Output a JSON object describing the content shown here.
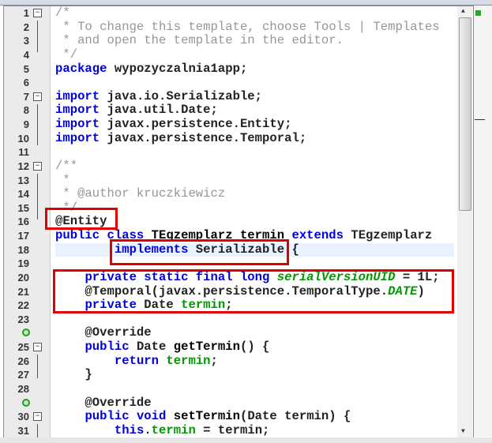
{
  "editor": {
    "current_line": 18,
    "lines": [
      [
        {
          "t": "/*",
          "c": "cm"
        }
      ],
      [
        {
          "t": " * To change this template, choose Tools | Templates",
          "c": "cm"
        }
      ],
      [
        {
          "t": " * and open the template in the editor.",
          "c": "cm"
        }
      ],
      [
        {
          "t": " */",
          "c": "cm"
        }
      ],
      [
        {
          "t": "package",
          "c": "k"
        },
        {
          "t": " wypozyczalnia1app;",
          "c": "a"
        }
      ],
      [],
      [
        {
          "t": "import",
          "c": "k"
        },
        {
          "t": " java.io.Serializable;",
          "c": "a"
        }
      ],
      [
        {
          "t": "import",
          "c": "k"
        },
        {
          "t": " java.util.Date;",
          "c": "a"
        }
      ],
      [
        {
          "t": "import",
          "c": "k"
        },
        {
          "t": " javax.persistence.Entity;",
          "c": "a"
        }
      ],
      [
        {
          "t": "import",
          "c": "k"
        },
        {
          "t": " javax.persistence.Temporal;",
          "c": "a"
        }
      ],
      [],
      [
        {
          "t": "/**",
          "c": "cm"
        }
      ],
      [
        {
          "t": " *",
          "c": "cm"
        }
      ],
      [
        {
          "t": " * @author kruczkiewicz",
          "c": "cm"
        }
      ],
      [
        {
          "t": " */",
          "c": "cm"
        }
      ],
      [
        {
          "t": "@Entity",
          "c": "a"
        }
      ],
      [
        {
          "t": "public class",
          "c": "k"
        },
        {
          "t": " ",
          "c": "a"
        },
        {
          "t": "TEgzemplarz termin",
          "c": "b"
        },
        {
          "t": " ",
          "c": "a"
        },
        {
          "t": "extends",
          "c": "k"
        },
        {
          "t": " TEgzemplarz",
          "c": "a"
        }
      ],
      [
        {
          "t": "        ",
          "c": "a"
        },
        {
          "t": "implements",
          "c": "k"
        },
        {
          "t": " Serializable {",
          "c": "a"
        }
      ],
      [],
      [
        {
          "t": "    ",
          "c": "a"
        },
        {
          "t": "private static final long",
          "c": "k"
        },
        {
          "t": " ",
          "c": "a"
        },
        {
          "t": "serialVersionUID",
          "c": "fi"
        },
        {
          "t": " = 1L;",
          "c": "a"
        }
      ],
      [
        {
          "t": "    @Temporal(javax.persistence.TemporalType.",
          "c": "a"
        },
        {
          "t": "DATE",
          "c": "fi"
        },
        {
          "t": ")",
          "c": "a"
        }
      ],
      [
        {
          "t": "    ",
          "c": "a"
        },
        {
          "t": "private",
          "c": "k"
        },
        {
          "t": " Date ",
          "c": "a"
        },
        {
          "t": "termin",
          "c": "f"
        },
        {
          "t": ";",
          "c": "a"
        }
      ],
      [],
      [
        {
          "t": "    @Override",
          "c": "a"
        }
      ],
      [
        {
          "t": "    ",
          "c": "a"
        },
        {
          "t": "public",
          "c": "k"
        },
        {
          "t": " Date ",
          "c": "a"
        },
        {
          "t": "getTermin",
          "c": "b"
        },
        {
          "t": "() {",
          "c": "a"
        }
      ],
      [
        {
          "t": "        ",
          "c": "a"
        },
        {
          "t": "return",
          "c": "k"
        },
        {
          "t": " ",
          "c": "a"
        },
        {
          "t": "termin",
          "c": "f"
        },
        {
          "t": ";",
          "c": "a"
        }
      ],
      [
        {
          "t": "    }",
          "c": "a"
        }
      ],
      [],
      [
        {
          "t": "    @Override",
          "c": "a"
        }
      ],
      [
        {
          "t": "    ",
          "c": "a"
        },
        {
          "t": "public void",
          "c": "k"
        },
        {
          "t": " ",
          "c": "a"
        },
        {
          "t": "setTermin",
          "c": "b"
        },
        {
          "t": "(Date termin) {",
          "c": "a"
        }
      ],
      [
        {
          "t": "        ",
          "c": "a"
        },
        {
          "t": "this",
          "c": "k"
        },
        {
          "t": ".",
          "c": "a"
        },
        {
          "t": "termin",
          "c": "f"
        },
        {
          "t": " = termin;",
          "c": "a"
        }
      ]
    ],
    "line_numbers": [
      "1",
      "2",
      "3",
      "4",
      "5",
      "6",
      "7",
      "8",
      "9",
      "10",
      "11",
      "12",
      "13",
      "14",
      "15",
      "16",
      "17",
      "18",
      "19",
      "20",
      "21",
      "22",
      "23",
      "",
      "25",
      "26",
      "27",
      "28",
      "",
      "30",
      "31"
    ],
    "override_marker_lines": [
      24,
      29
    ],
    "fold_lines": [
      1,
      7,
      12,
      25,
      30
    ],
    "highlight_color": "#e00000"
  }
}
